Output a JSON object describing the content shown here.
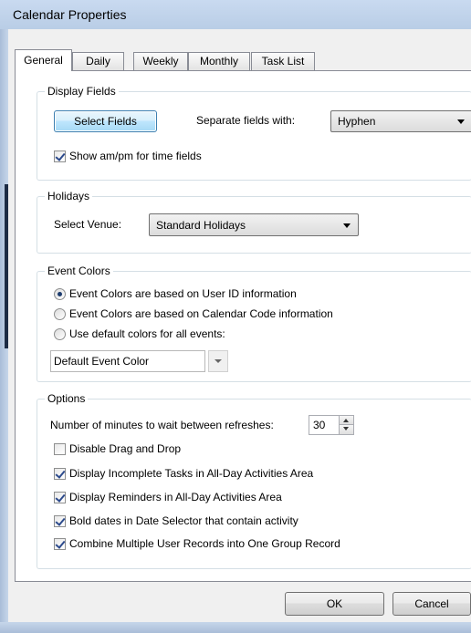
{
  "window": {
    "title": "Calendar Properties"
  },
  "tabs": [
    {
      "label": "General",
      "active": true
    },
    {
      "label": "Daily"
    },
    {
      "label": "Weekly"
    },
    {
      "label": "Monthly"
    },
    {
      "label": "Task List"
    }
  ],
  "display_fields": {
    "legend": "Display Fields",
    "select_fields_label": "Select Fields",
    "separate_label": "Separate fields with:",
    "separator_value": "Hyphen",
    "ampm_label": "Show am/pm for time fields",
    "ampm_checked": true
  },
  "holidays": {
    "legend": "Holidays",
    "venue_label": "Select Venue:",
    "venue_value": "Standard Holidays"
  },
  "event_colors": {
    "legend": "Event Colors",
    "options": [
      {
        "label": "Event Colors are based on User ID information",
        "selected": true
      },
      {
        "label": "Event Colors are based on Calendar Code information",
        "selected": false
      },
      {
        "label": "Use default colors for all events:",
        "selected": false
      }
    ],
    "default_color_value": "Default Event Color"
  },
  "options": {
    "legend": "Options",
    "refresh_label": "Number of minutes to wait between refreshes:",
    "refresh_value": "30",
    "checks": [
      {
        "label": "Disable Drag and Drop",
        "checked": false
      },
      {
        "label": "Display Incomplete Tasks in All-Day Activities Area",
        "checked": true
      },
      {
        "label": "Display Reminders in All-Day Activities Area",
        "checked": true
      },
      {
        "label": "Bold dates in Date Selector that contain activity",
        "checked": true
      },
      {
        "label": "Combine Multiple User Records into One Group Record",
        "checked": true
      }
    ]
  },
  "buttons": {
    "ok_label": "OK",
    "cancel_label": "Cancel"
  },
  "icons": {
    "dropdown": "chevron-down-icon",
    "spin_up": "spin-up-icon",
    "spin_down": "spin-down-icon"
  }
}
